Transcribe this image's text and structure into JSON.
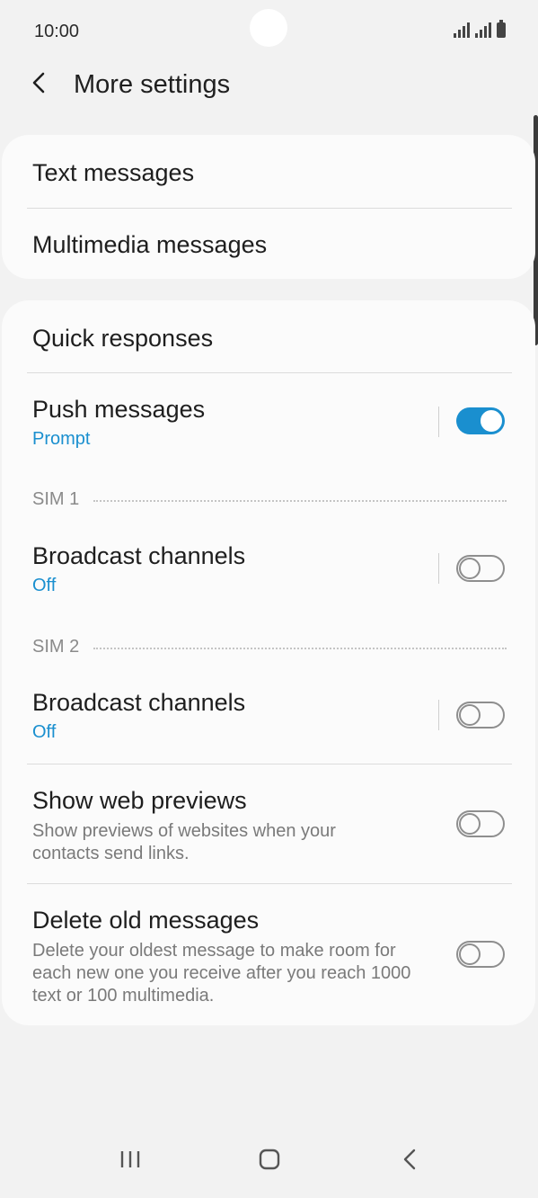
{
  "status": {
    "time": "10:00"
  },
  "header": {
    "title": "More settings"
  },
  "group1": {
    "text_messages": "Text messages",
    "multimedia_messages": "Multimedia messages"
  },
  "group2": {
    "quick_responses": "Quick responses",
    "push_messages": {
      "title": "Push messages",
      "subtitle": "Prompt",
      "enabled": true
    },
    "sim1": {
      "label": "SIM 1",
      "title": "Broadcast channels",
      "subtitle": "Off",
      "enabled": false
    },
    "sim2": {
      "label": "SIM 2",
      "title": "Broadcast channels",
      "subtitle": "Off",
      "enabled": false
    },
    "web_previews": {
      "title": "Show web previews",
      "description": "Show previews of websites when your contacts send links.",
      "enabled": false
    },
    "delete_old": {
      "title": "Delete old messages",
      "description": "Delete your oldest message to make room for each new one you receive after you reach 1000 text or 100 multimedia.",
      "enabled": false
    }
  },
  "colors": {
    "accent": "#1a8fcf",
    "background": "#f2f2f2",
    "card": "#fbfbfb"
  }
}
